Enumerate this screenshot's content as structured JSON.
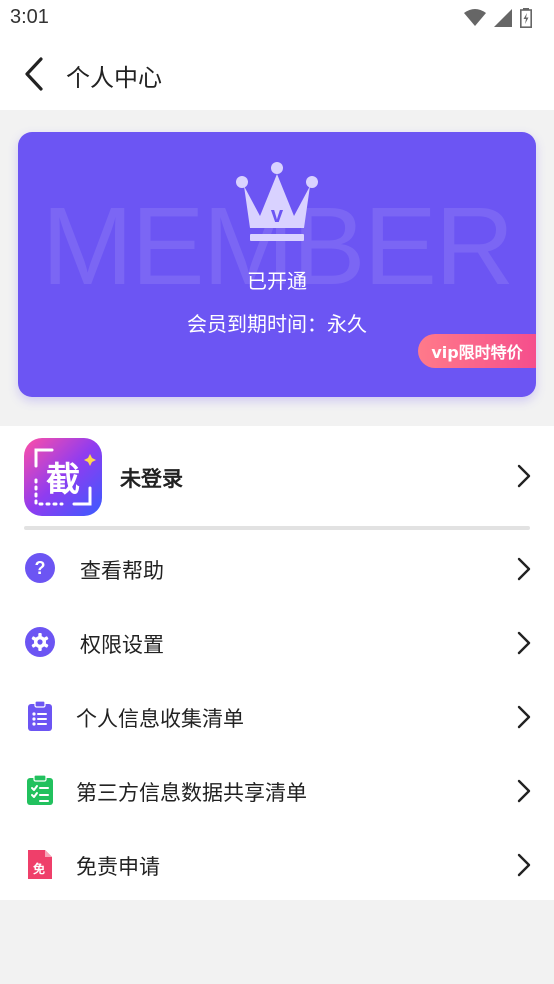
{
  "status_bar": {
    "time": "3:01"
  },
  "header": {
    "title": "个人中心"
  },
  "member_card": {
    "watermark": "MEMBER",
    "crown_letter": "v",
    "status": "已开通",
    "expire_text": "会员到期时间：永久",
    "badge": "vip限时特价",
    "background_color": "#6c55f3"
  },
  "account": {
    "app_icon_char": "截",
    "login_label": "未登录"
  },
  "menu": {
    "items": [
      {
        "label": "查看帮助",
        "icon": "help-icon"
      },
      {
        "label": "权限设置",
        "icon": "gear-icon"
      },
      {
        "label": "个人信息收集清单",
        "icon": "clipboard-list-icon"
      },
      {
        "label": "第三方信息数据共享清单",
        "icon": "clipboard-check-icon"
      },
      {
        "label": "免责申请",
        "icon": "document-free-icon"
      }
    ]
  },
  "colors": {
    "accent": "#6c55f3",
    "badge_pink": "#f54e8c",
    "green": "#22c15e",
    "red": "#ef3f6a"
  }
}
